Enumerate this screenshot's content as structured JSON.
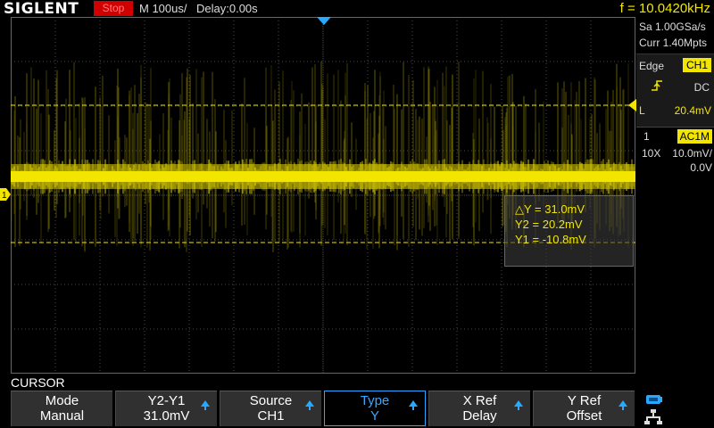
{
  "topbar": {
    "brand": "SIGLENT",
    "run_state": "Stop",
    "timebase": "M 100us/",
    "delay": "Delay:0.00s",
    "frequency": "f = 10.0420kHz"
  },
  "acquisition": {
    "sample_rate": "Sa 1.00GSa/s",
    "memory_depth": "Curr 1.40Mpts"
  },
  "trigger": {
    "type": "Edge",
    "source": "CH1",
    "slope_icon": "rising-edge-icon",
    "coupling": "DC",
    "level_label": "L",
    "level": "20.4mV"
  },
  "channel1": {
    "number": "1",
    "coupling": "AC1M",
    "probe": "10X",
    "volts_per_div": "10.0mV/",
    "offset": "0.0V"
  },
  "cursor_readout": {
    "delta_y": "△Y = 31.0mV",
    "y2": "Y2 = 20.2mV",
    "y1": "Y1 = -10.8mV"
  },
  "menu": {
    "title": "CURSOR",
    "softkeys": [
      {
        "label": "Mode",
        "value": "Manual",
        "has_arrow": false,
        "active": false
      },
      {
        "label": "Y2-Y1",
        "value": "31.0mV",
        "has_arrow": true,
        "active": false
      },
      {
        "label": "Source",
        "value": "CH1",
        "has_arrow": true,
        "active": false
      },
      {
        "label": "Type",
        "value": "Y",
        "has_arrow": true,
        "active": true
      },
      {
        "label": "X Ref",
        "value": "Delay",
        "has_arrow": true,
        "active": false
      },
      {
        "label": "Y Ref",
        "value": "Offset",
        "has_arrow": true,
        "active": false
      }
    ]
  },
  "colors": {
    "channel1": "#f2e600",
    "accent_blue": "#29a8ff",
    "stop_red": "#d10000",
    "grid": "#4a4a4a"
  }
}
